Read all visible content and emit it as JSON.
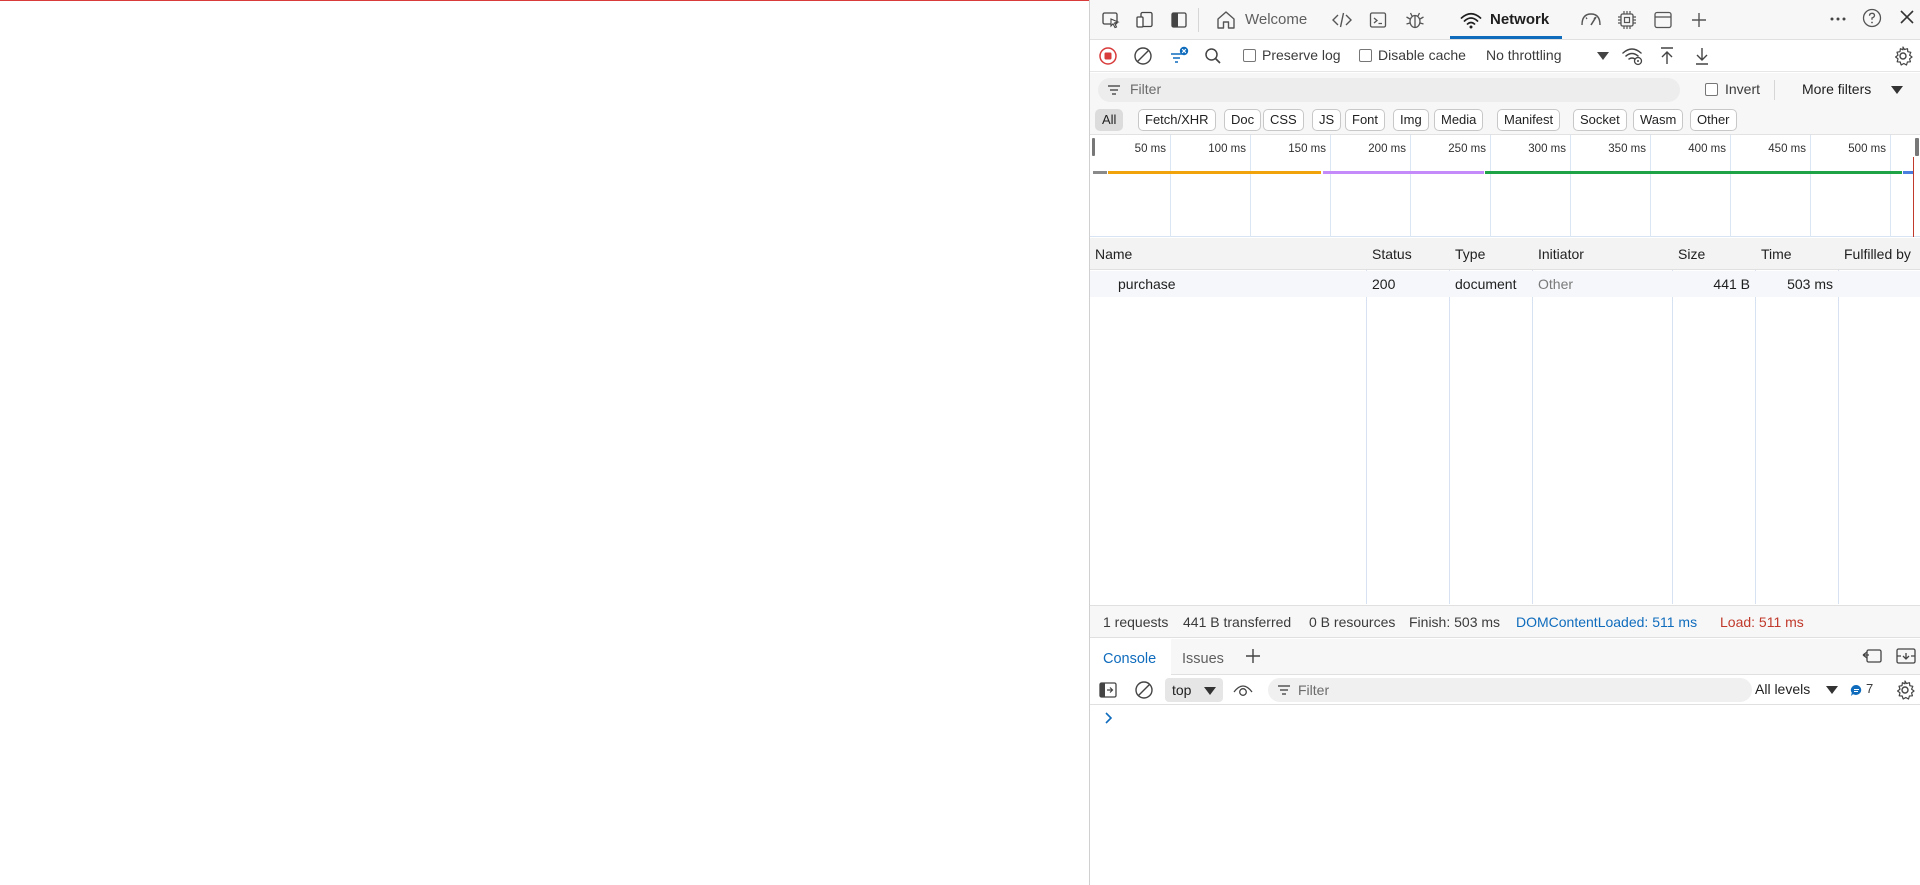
{
  "devtools": {
    "tabs": [
      {
        "label": "Welcome"
      },
      {
        "label": "Network"
      }
    ],
    "toolbar": {
      "preserve_log": "Preserve log",
      "disable_cache": "Disable cache",
      "throttling": "No throttling"
    },
    "filter": {
      "placeholder": "Filter",
      "invert": "Invert",
      "more_filters": "More filters"
    },
    "type_filters": [
      "All",
      "Fetch/XHR",
      "Doc",
      "CSS",
      "JS",
      "Font",
      "Img",
      "Media",
      "Manifest",
      "Socket",
      "Wasm",
      "Other"
    ],
    "overview": {
      "ticks": [
        "50 ms",
        "100 ms",
        "150 ms",
        "200 ms",
        "250 ms",
        "300 ms",
        "350 ms",
        "400 ms",
        "450 ms",
        "500 ms"
      ],
      "colors": {
        "waiting": "#f0a30a",
        "stalled": "#c58af9",
        "download": "#1ea446",
        "queued": "#8a8a8a",
        "dom": "#4a7fe0",
        "load": "#c0392b"
      }
    },
    "table": {
      "columns": [
        "Name",
        "Status",
        "Type",
        "Initiator",
        "Size",
        "Time",
        "Fulfilled by"
      ],
      "rows": [
        {
          "name": "purchase",
          "status": "200",
          "type": "document",
          "initiator": "Other",
          "size": "441 B",
          "time": "503 ms",
          "fulfilled_by": ""
        }
      ]
    },
    "summary": {
      "requests": "1 requests",
      "transferred": "441 B transferred",
      "resources": "0 B resources",
      "finish": "Finish: 503 ms",
      "dom_content_loaded": "DOMContentLoaded: 511 ms",
      "load": "Load: 511 ms",
      "dcl_color": "#0f6cbd",
      "load_color": "#c0392b"
    },
    "drawer": {
      "tabs": [
        {
          "label": "Console"
        },
        {
          "label": "Issues"
        }
      ],
      "context": "top",
      "filter_placeholder": "Filter",
      "levels": "All levels",
      "message_count": "7"
    }
  },
  "accent_color": "#0f6cbd"
}
